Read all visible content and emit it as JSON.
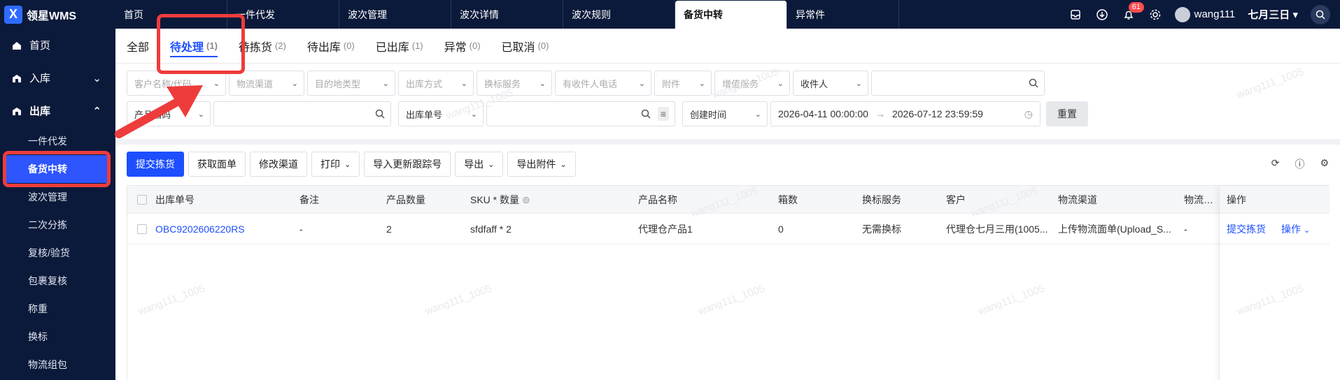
{
  "brand": {
    "logo": "X",
    "name": "领星WMS"
  },
  "top_tabs": [
    {
      "label": "首页"
    },
    {
      "label": "一件代发"
    },
    {
      "label": "波次管理"
    },
    {
      "label": "波次详情"
    },
    {
      "label": "波次规则"
    },
    {
      "label": "备货中转",
      "active": true
    },
    {
      "label": "异常件"
    }
  ],
  "top_right": {
    "notif_count": "61",
    "username": "wang111",
    "date_select": "七月三日"
  },
  "sidebar": {
    "items": [
      {
        "label": "首页",
        "icon": "home-icon"
      },
      {
        "label": "入库",
        "icon": "inbound-icon"
      },
      {
        "label": "出库",
        "icon": "outbound-icon"
      }
    ],
    "sub_items": [
      {
        "label": "一件代发"
      },
      {
        "label": "备货中转",
        "active": true
      },
      {
        "label": "波次管理"
      },
      {
        "label": "二次分拣"
      },
      {
        "label": "复核/验货"
      },
      {
        "label": "包裹复核"
      },
      {
        "label": "称重"
      },
      {
        "label": "换标"
      },
      {
        "label": "物流组包"
      }
    ]
  },
  "sub_tabs": [
    {
      "label": "全部",
      "count": ""
    },
    {
      "label": "待处理",
      "count": "(1)",
      "active": true
    },
    {
      "label": "待拣货",
      "count": "(2)"
    },
    {
      "label": "待出库",
      "count": "(0)"
    },
    {
      "label": "已出库",
      "count": "(1)"
    },
    {
      "label": "异常",
      "count": "(0)"
    },
    {
      "label": "已取消",
      "count": "(0)"
    }
  ],
  "filters": {
    "row1": [
      "客户名称/代码",
      "物流渠道",
      "目的地类型",
      "出库方式",
      "换标服务",
      "有收件人电话",
      "附件",
      "增值服务"
    ],
    "recipient_select": "收件人",
    "row2_sel1": "产品编码",
    "row2_sel2": "出库单号",
    "date_type": "创建时间",
    "date_start": "2026-04-11 00:00:00",
    "date_end": "2026-07-12 23:59:59",
    "reset": "重置"
  },
  "toolbar": {
    "submit": "提交拣货",
    "get_label": "获取面单",
    "change_channel": "修改渠道",
    "print": "打印",
    "import_tracking": "导入更新跟踪号",
    "export": "导出",
    "export_attach": "导出附件"
  },
  "table": {
    "headers": [
      "出库单号",
      "备注",
      "产品数量",
      "SKU * 数量",
      "产品名称",
      "箱数",
      "换标服务",
      "客户",
      "物流渠道",
      "物流跟踪"
    ],
    "op_header": "操作",
    "rows": [
      {
        "cells": [
          "OBC9202606220RS",
          "-",
          "2",
          "sfdfaff * 2",
          "代理仓产品1",
          "0",
          "无需换标",
          "代理仓七月三用(1005...",
          "上传物流面单(Upload_S...",
          "-"
        ],
        "op_submit": "提交拣货",
        "op_more": "操作"
      }
    ]
  },
  "watermark": "wang111_1005",
  "colors": {
    "accent": "#1d4fff",
    "nav_bg": "#0b1a3b",
    "annotation": "#ee3c3c"
  }
}
